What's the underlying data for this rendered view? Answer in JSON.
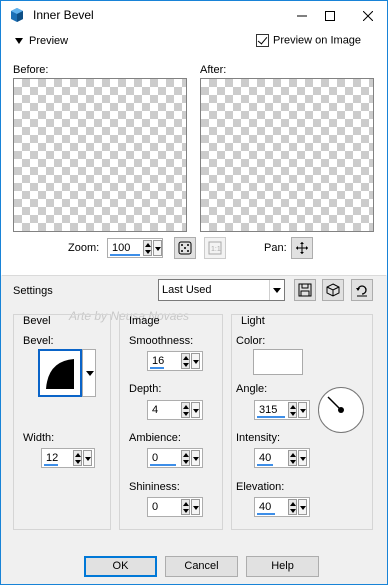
{
  "window": {
    "title": "Inner Bevel",
    "minimize_icon": "minimize-icon",
    "maximize_icon": "maximize-icon",
    "close_icon": "close-icon"
  },
  "preview": {
    "toggle_label": "Preview",
    "preview_on_image_label": "Preview on Image",
    "preview_on_image_checked": true,
    "before_label": "Before:",
    "after_label": "After:",
    "zoom_label": "Zoom:",
    "zoom_value": "100",
    "pan_label": "Pan:"
  },
  "settings": {
    "label": "Settings",
    "preset_value": "Last Used"
  },
  "watermark": "Arte by Neusa Novaes",
  "bevel": {
    "group_label": "Bevel",
    "bevel_label": "Bevel:",
    "width_label": "Width:",
    "width_value": "12"
  },
  "image": {
    "group_label": "Image",
    "smoothness_label": "Smoothness:",
    "smoothness_value": "16",
    "depth_label": "Depth:",
    "depth_value": "4",
    "ambience_label": "Ambience:",
    "ambience_value": "0",
    "shininess_label": "Shininess:",
    "shininess_value": "0"
  },
  "light": {
    "group_label": "Light",
    "color_label": "Color:",
    "color_value": "#ffffff",
    "angle_label": "Angle:",
    "angle_value": "315",
    "intensity_label": "Intensity:",
    "intensity_value": "40",
    "elevation_label": "Elevation:",
    "elevation_value": "40"
  },
  "buttons": {
    "ok": "OK",
    "cancel": "Cancel",
    "help": "Help"
  },
  "colors": {
    "accent": "#0078d7",
    "window_border": "#1883d7"
  }
}
